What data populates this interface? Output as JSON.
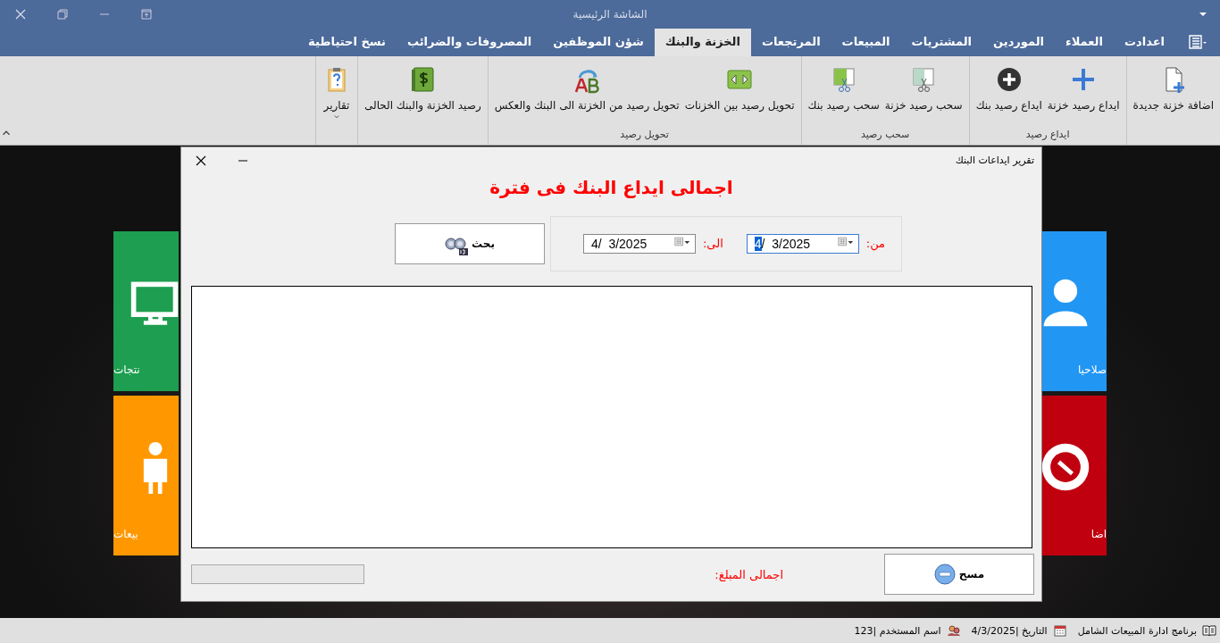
{
  "window": {
    "title": "الشاشة الرئيسية"
  },
  "tabs": [
    {
      "label": "اعدادت",
      "selected": false
    },
    {
      "label": "العملاء",
      "selected": false
    },
    {
      "label": "الموردين",
      "selected": false
    },
    {
      "label": "المشتريات",
      "selected": false
    },
    {
      "label": "المبيعات",
      "selected": false
    },
    {
      "label": "المرتجعات",
      "selected": false
    },
    {
      "label": "الخزنة والبنك",
      "selected": true
    },
    {
      "label": "شؤن الموظفين",
      "selected": false
    },
    {
      "label": "المصروفات والضرائب",
      "selected": false
    },
    {
      "label": "نسخ احتياطية",
      "selected": false
    }
  ],
  "ribbon_groups": [
    {
      "buttons": [
        {
          "label": "اضافة خزنة جديدة",
          "dropdown": false
        }
      ]
    },
    {
      "label": "ايداع رصيد",
      "buttons": [
        {
          "label": "ايداع رصيد خزنة",
          "dropdown": false
        },
        {
          "label": "ايداع رصيد بنك",
          "dropdown": false
        }
      ]
    },
    {
      "label": "سحب رصيد",
      "buttons": [
        {
          "label": "سحب رصيد خزنة",
          "dropdown": false
        },
        {
          "label": "سحب رصيد بنك",
          "dropdown": false
        }
      ]
    },
    {
      "label": "تحويل رصيد",
      "buttons": [
        {
          "label": "تحويل رصيد بين الخزنات",
          "dropdown": false
        },
        {
          "label": "تحويل رصيد من الخزنة الى البنك والعكس",
          "dropdown": false
        }
      ]
    },
    {
      "buttons": [
        {
          "label": "رصيد الخزنة والبنك الحالى",
          "dropdown": false
        }
      ]
    },
    {
      "buttons": [
        {
          "label": "تقارير",
          "dropdown": true
        }
      ]
    }
  ],
  "tiles": [
    {
      "label": "صلاحيا",
      "color": "#2196f3"
    },
    {
      "label": "نتجات",
      "color": "#1e9e50"
    },
    {
      "label": "اضا",
      "color": "#c0000f"
    },
    {
      "label": "بيعات",
      "color": "#ff9800"
    }
  ],
  "dialog": {
    "title": "تقرير ايداعات البنك",
    "heading": "اجمالى ايداع البنك فى فترة",
    "from_label": "من:",
    "from_date": {
      "value": "4/  3/2025",
      "focused": true
    },
    "to_label": "الى:",
    "to_date": {
      "value": "4/  3/2025",
      "focused": false
    },
    "search_button": "بحث",
    "clear_button": "مسح",
    "total_label": "اجمالى المبلغ:"
  },
  "status_bar": {
    "app_name": "برنامج ادارة المبيعات الشامل",
    "date": "التاريخ |4/3/2025",
    "user": "اسم المستخدم |123"
  }
}
